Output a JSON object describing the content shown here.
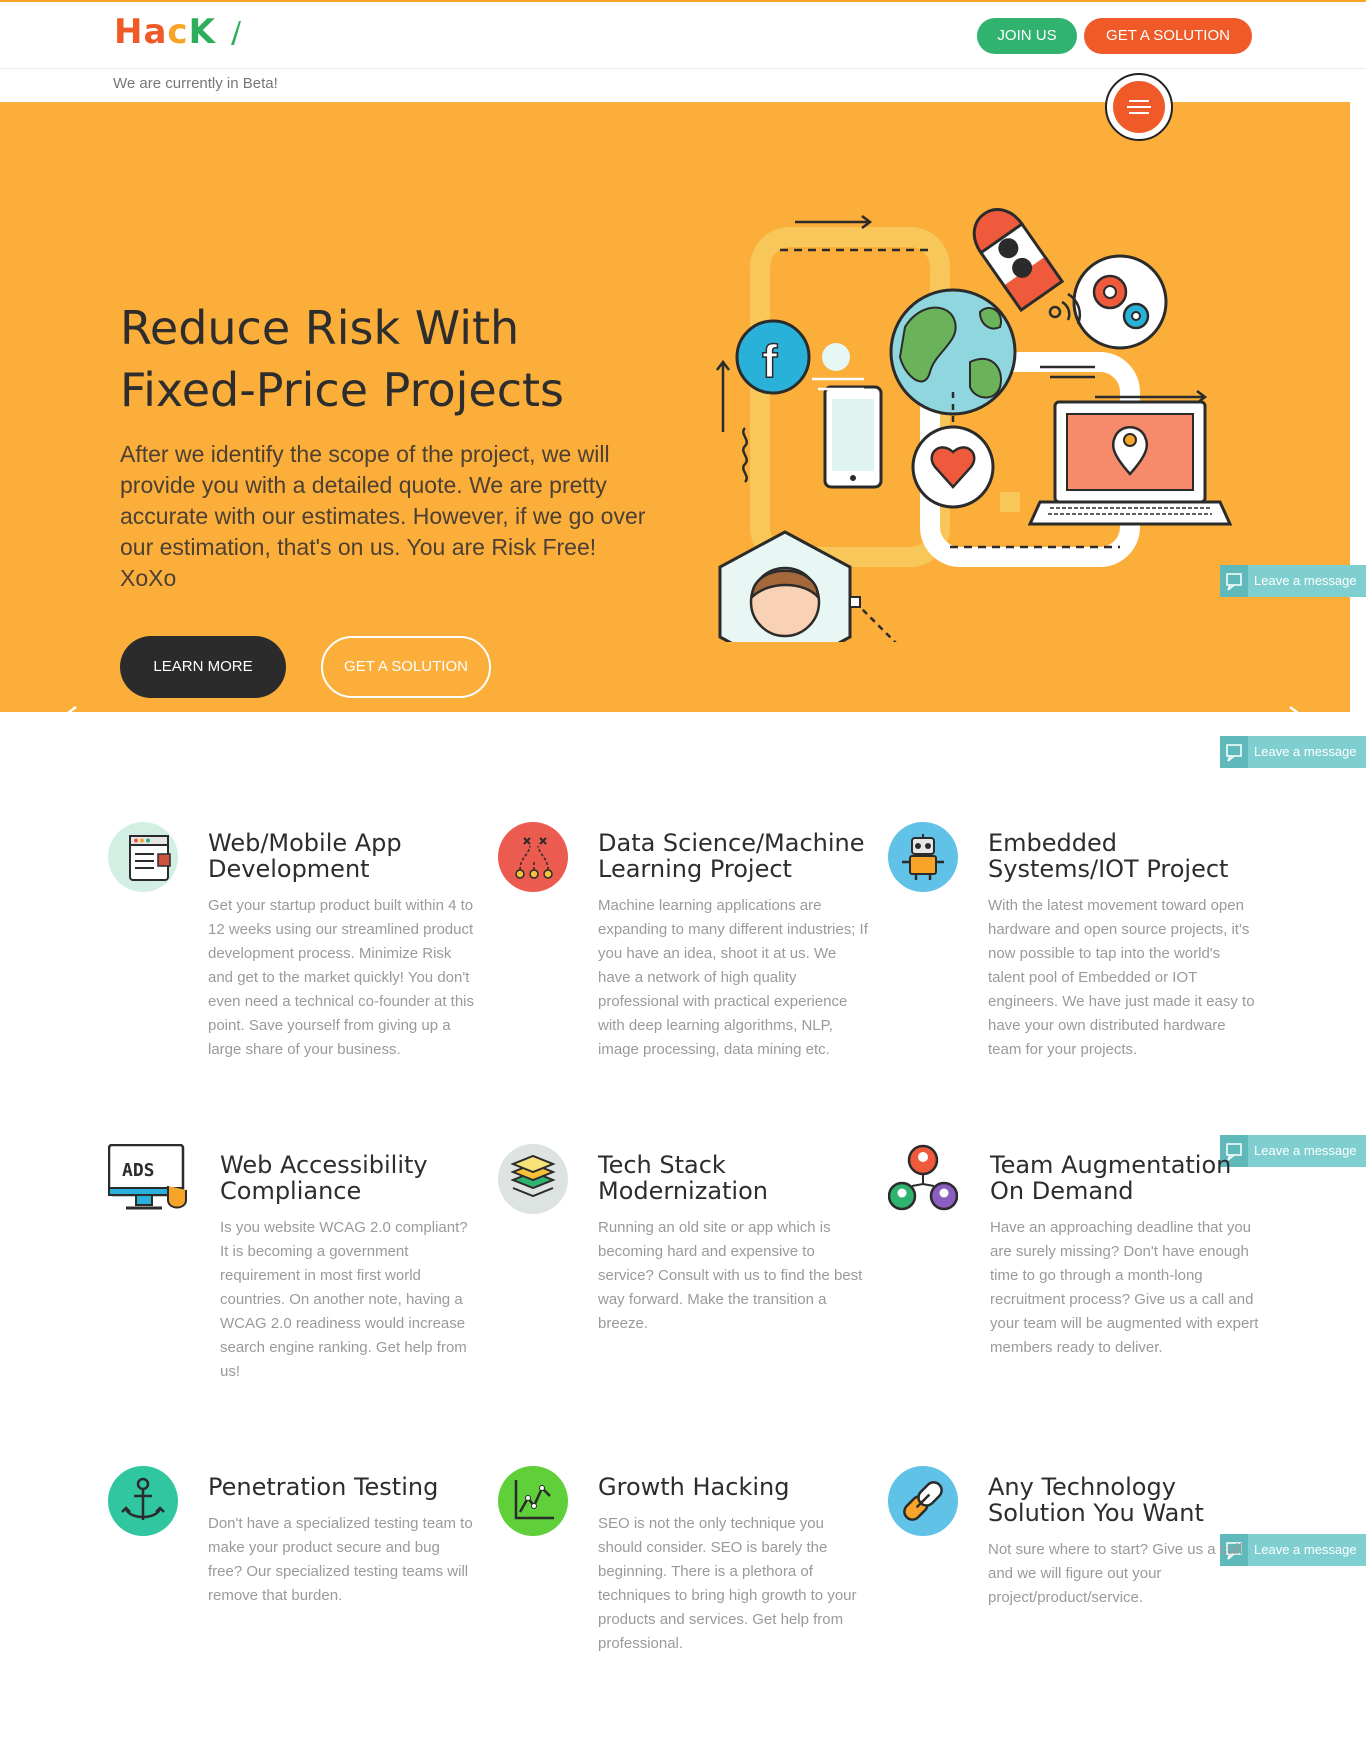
{
  "header": {
    "logo": {
      "part1": "Ha",
      "part2": "c",
      "part3": "K"
    },
    "join_label": "JOIN US",
    "solution_label": "GET A SOLUTION",
    "beta_text": "We are currently in Beta!"
  },
  "hero": {
    "title_line1": "Reduce Risk With",
    "title_line2": "Fixed-Price Projects",
    "text": "After we identify the scope of the project, we will provide you with a detailed quote. We are pretty accurate with our estimates. However, if we go over our estimation, that's on us. You are Risk Free! XoXo",
    "learn_more": "LEARN MORE",
    "get_solution": "GET A SOLUTION"
  },
  "leave_message": "Leave a message",
  "services": [
    {
      "title": "Web/Mobile App Development",
      "icon": "browser-window-icon",
      "text": "Get your startup product built within 4 to 12 weeks using our streamlined product development process. Minimize Risk and get to the market quickly! You don't even need a technical co-founder at this point. Save yourself from giving up a large share of your business."
    },
    {
      "title": "Data Science/Machine Learning Project",
      "icon": "strategy-graph-icon",
      "text": "Machine learning applications are expanding to many different industries; If you have an idea, shoot it at us. We have a network of high quality professional with practical experience with deep learning algorithms, NLP, image processing, data mining etc."
    },
    {
      "title": "Embedded Systems/IOT Project",
      "icon": "robot-icon",
      "text": "With the latest movement toward open hardware and open source projects, it's now possible to tap into the world's talent pool of Embedded or IOT engineers. We have just made it easy to have your own distributed hardware team for your projects."
    },
    {
      "title": "Web Accessibility Compliance",
      "icon": "ada-monitor-icon",
      "text": "Is you website WCAG 2.0 compliant? It is becoming a government requirement in most first world countries. On another note, having a WCAG 2.0 readiness would increase search engine ranking. Get help from us!"
    },
    {
      "title": "Tech Stack Modernization",
      "icon": "layers-icon",
      "text": "Running an old site or app which is becoming hard and expensive to service? Consult with us to find the best way forward. Make the transition a breeze."
    },
    {
      "title": "Team Augmentation On Demand",
      "icon": "team-network-icon",
      "text": "Have an approaching deadline that you are surely missing? Don't have enough time to go through a month-long recruitment process? Give us a call and your team will be augmented with expert members ready to deliver."
    },
    {
      "title": "Penetration Testing",
      "icon": "anchor-icon",
      "text": "Don't have a specialized testing team to make your product secure and bug free? Our specialized testing teams will remove that burden."
    },
    {
      "title": "Growth Hacking",
      "icon": "growth-chart-icon",
      "text": "SEO is not the only technique you should consider. SEO is barely the beginning. There is a plethora of techniques to bring high growth to your products and services. Get help from professional."
    },
    {
      "title": "Any Technology Solution You Want",
      "icon": "chain-link-icon",
      "text": "Not sure where to start? Give us a call and we will figure out your project/product/service."
    }
  ],
  "colors": {
    "orange": "#fbae3a",
    "red": "#f05a28",
    "green": "#2fb36f",
    "teal": "#7fcfd0"
  }
}
